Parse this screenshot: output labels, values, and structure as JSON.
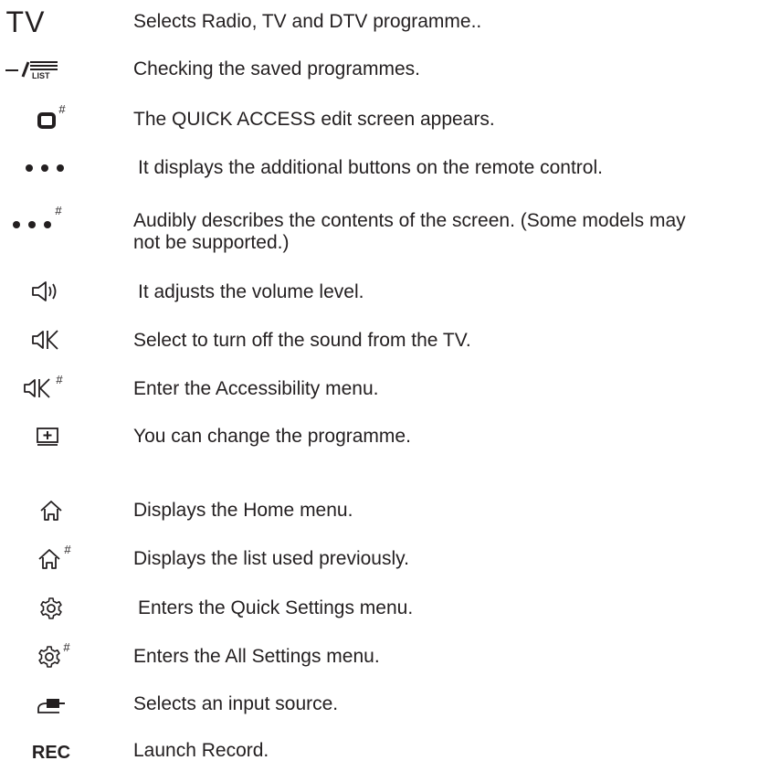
{
  "icon_labels": {
    "tv": "TV",
    "rec": "REC",
    "list": "LIST",
    "hash": "#"
  },
  "items": [
    {
      "icon": "tv-text-icon",
      "text": "Selects Radio, TV and DTV programme.."
    },
    {
      "icon": "dash-list-icon",
      "text": "Checking the saved programmes."
    },
    {
      "icon": "quick-access-icon",
      "text": "The QUICK ACCESS edit screen appears."
    },
    {
      "icon": "more-dots-icon",
      "text": " It displays the additional buttons on the remote control."
    },
    {
      "icon": "more-dots-hash-icon",
      "text": "Audibly describes the contents of the screen. (Some models may\nnot be supported.)"
    },
    {
      "icon": "volume-icon",
      "text": " It adjusts the volume level."
    },
    {
      "icon": "mute-icon",
      "text": "Select to turn off the sound from the TV."
    },
    {
      "icon": "mute-hash-icon",
      "text": "Enter the Accessibility menu."
    },
    {
      "icon": "programme-icon",
      "text": "You can change the programme."
    },
    {
      "icon": "home-icon",
      "text": "Displays the Home menu."
    },
    {
      "icon": "home-hash-icon",
      "text": "Displays the list used previously."
    },
    {
      "icon": "settings-icon",
      "text": " Enters the Quick Settings menu."
    },
    {
      "icon": "settings-hash-icon",
      "text": "Enters the All Settings menu."
    },
    {
      "icon": "input-source-icon",
      "text": "Selects an input source."
    },
    {
      "icon": "rec-text-icon",
      "text": "Launch Record."
    }
  ]
}
